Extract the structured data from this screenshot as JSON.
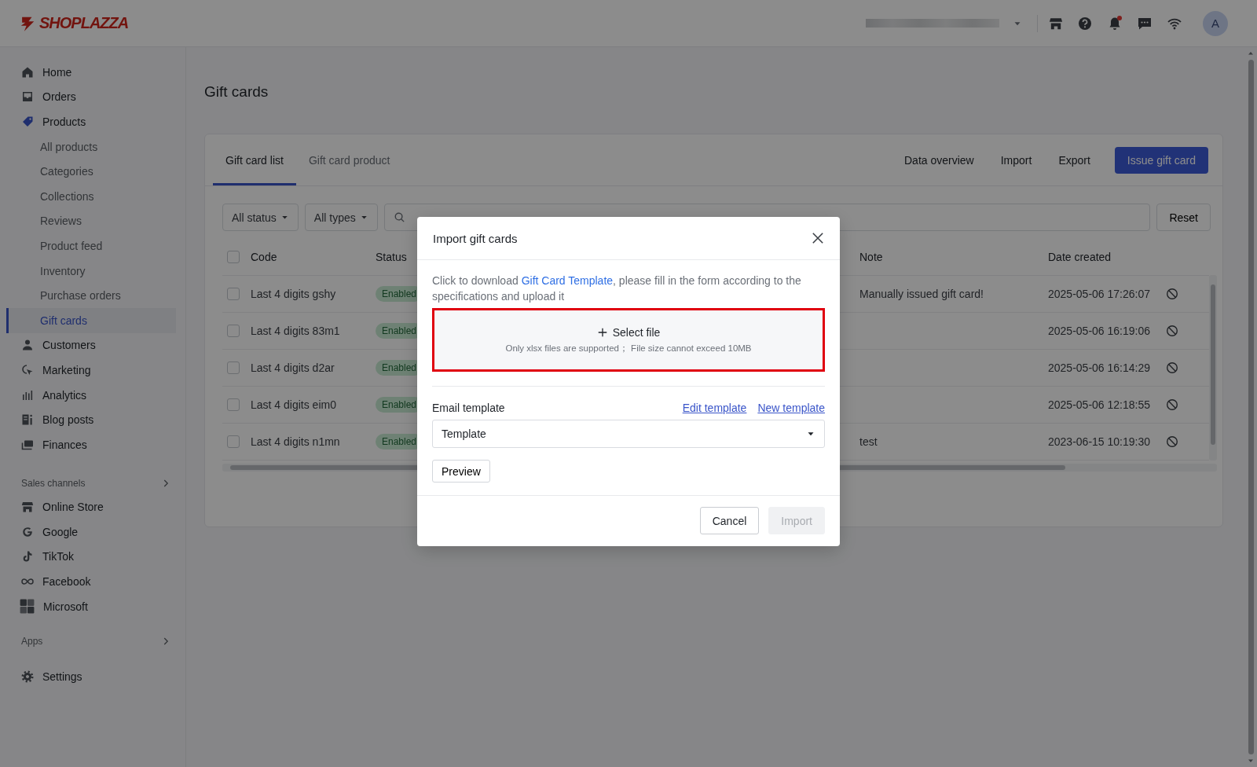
{
  "topbar": {
    "logo": "SHOPLAZZA",
    "notifications_unread": true,
    "avatar": "A"
  },
  "sidebar": {
    "items": [
      {
        "label": "Home",
        "selected": false
      },
      {
        "label": "Orders",
        "selected": false
      },
      {
        "label": "Products",
        "selected": false,
        "children": [
          {
            "label": "All products",
            "selected": false
          },
          {
            "label": "Categories",
            "selected": false
          },
          {
            "label": "Collections",
            "selected": false
          },
          {
            "label": "Reviews",
            "selected": false
          },
          {
            "label": "Product feed",
            "selected": false
          },
          {
            "label": "Inventory",
            "selected": false
          },
          {
            "label": "Purchase orders",
            "selected": false
          },
          {
            "label": "Gift cards",
            "selected": true
          }
        ]
      },
      {
        "label": "Customers",
        "selected": false
      },
      {
        "label": "Marketing",
        "selected": false
      },
      {
        "label": "Analytics",
        "selected": false
      },
      {
        "label": "Blog posts",
        "selected": false
      },
      {
        "label": "Finances",
        "selected": false
      }
    ],
    "sections": [
      {
        "title": "Sales channels",
        "items": [
          {
            "label": "Online Store",
            "selected": false
          },
          {
            "label": "Google",
            "selected": false
          },
          {
            "label": "TikTok",
            "selected": false
          },
          {
            "label": "Facebook",
            "selected": false
          },
          {
            "label": "Microsoft",
            "selected": false
          }
        ]
      },
      {
        "title": "Apps"
      }
    ],
    "footer": [
      {
        "label": "Settings",
        "selected": false
      }
    ]
  },
  "page": {
    "title": "Gift cards",
    "tabs": [
      {
        "label": "Gift card list",
        "selected": true
      },
      {
        "label": "Gift card product",
        "selected": false
      }
    ],
    "actions": [
      "Data overview",
      "Import",
      "Export"
    ],
    "primary_action": "Issue gift card",
    "filters": [
      "All status",
      "All types"
    ],
    "reset": "Reset",
    "table": {
      "columns": [
        "Code",
        "Status",
        "Note",
        "Date created"
      ],
      "all_checked": false,
      "rows": [
        {
          "code": "Last 4 digits gshy",
          "status": "Enabled",
          "note": "Manually issued gift card!",
          "date": "2025-05-06 17:26:07",
          "checked": false
        },
        {
          "code": "Last 4 digits 83m1",
          "status": "Enabled",
          "date": "2025-05-06 16:19:06",
          "checked": false
        },
        {
          "code": "Last 4 digits d2ar",
          "status": "Enabled",
          "date": "2025-05-06 16:14:29",
          "checked": false
        },
        {
          "code": "Last 4 digits eim0",
          "status": "Enabled",
          "date": "2025-05-06 12:18:55",
          "checked": false
        },
        {
          "code": "Last 4 digits n1mn",
          "status": "Enabled",
          "note": "test",
          "date": "2023-06-15 10:19:30",
          "checked": false
        }
      ]
    }
  },
  "modal": {
    "title": "Import gift cards",
    "intro_before": "Click to download ",
    "intro_link": "Gift Card Template",
    "intro_after": ", please fill in the form according to the specifications and upload it",
    "upload": {
      "label": "Select file",
      "hint": "Only xlsx files are supported； File size cannot exceed 10MB",
      "highlighted": true
    },
    "email_template": {
      "label": "Email template",
      "links": [
        "Edit template",
        "New template"
      ],
      "value": "Template"
    },
    "preview": "Preview",
    "cancel": "Cancel",
    "import": {
      "label": "Import",
      "disabled": true
    }
  }
}
